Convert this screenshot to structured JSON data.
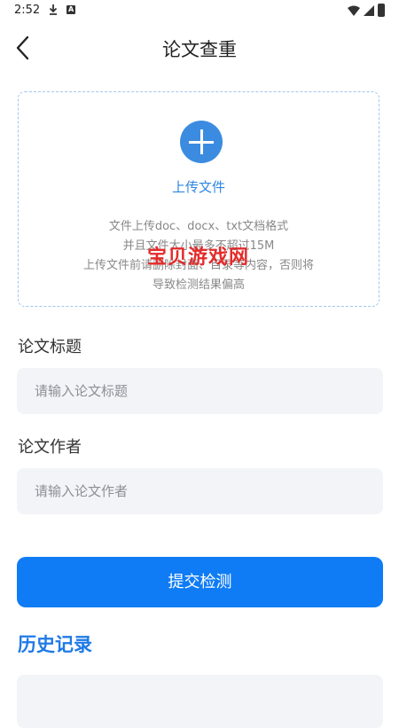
{
  "status_bar": {
    "time": "2:52",
    "icons": [
      "download-icon",
      "a-notification-icon",
      "wifi-icon",
      "cellular-icon",
      "battery-icon"
    ]
  },
  "header": {
    "title": "论文查重",
    "back_icon": "chevron-left-icon"
  },
  "upload": {
    "label": "上传文件",
    "hints": [
      "文件上传doc、docx、txt文档格式",
      "并且文件大小最多不超过15M",
      "上传文件前请删除封面、目录等内容，否则将",
      "导致检测结果偏高"
    ],
    "watermark": "宝贝游戏网",
    "colors": {
      "accent": "#3b8ce0",
      "border": "#9ec6f0"
    }
  },
  "form": {
    "title_label": "论文标题",
    "title_placeholder": "请输入论文标题",
    "title_value": "",
    "author_label": "论文作者",
    "author_placeholder": "请输入论文作者",
    "author_value": ""
  },
  "actions": {
    "submit_label": "提交检测",
    "submit_color": "#0f7cf5"
  },
  "history": {
    "title": "历史记录",
    "color": "#1f7ae6"
  }
}
